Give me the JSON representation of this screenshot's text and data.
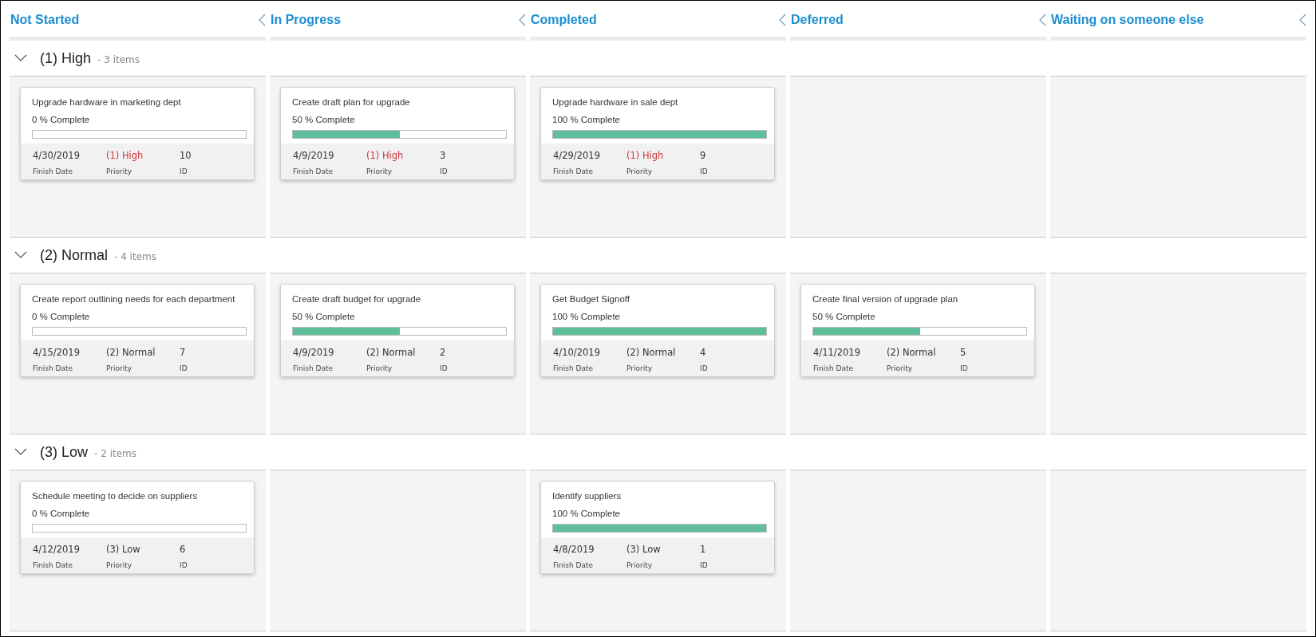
{
  "columns": [
    {
      "title": "Not Started",
      "kind": "not_started"
    },
    {
      "title": "In Progress",
      "kind": "in_progress"
    },
    {
      "title": "Completed",
      "kind": "completed"
    },
    {
      "title": "Deferred",
      "kind": "deferred"
    },
    {
      "title": "Waiting on someone else",
      "kind": "waiting"
    }
  ],
  "groups": [
    {
      "title": "(1) High",
      "count": "- 3 items",
      "expanded": true,
      "cards": [
        {
          "kind": "not_started",
          "title": "Upgrade hardware in marketing dept",
          "progress": "0 % Complete",
          "level": 0,
          "color": "#d13438",
          "fields": [
            {
              "value": "4/30/2019",
              "label": "Finish Date"
            },
            {
              "value": "(1) High",
              "label": "Priority"
            },
            {
              "value": "10",
              "label": "ID"
            }
          ]
        },
        {
          "kind": "in_progress",
          "title": "Create draft plan for upgrade",
          "progress": "50 % Complete",
          "level": 0.5,
          "color": "#d13438",
          "fields": [
            {
              "value": "4/9/2019",
              "label": "Finish Date"
            },
            {
              "value": "(1) High",
              "label": "Priority"
            },
            {
              "value": "3",
              "label": "ID"
            }
          ]
        },
        {
          "kind": "completed",
          "title": "Upgrade hardware in sale dept",
          "progress": "100 % Complete",
          "level": 1,
          "color": "#d13438",
          "fields": [
            {
              "value": "4/29/2019",
              "label": "Finish Date"
            },
            {
              "value": "(1) High",
              "label": "Priority"
            },
            {
              "value": "9",
              "label": "ID"
            }
          ]
        }
      ]
    },
    {
      "title": "(2) Normal",
      "count": "- 4 items",
      "expanded": true,
      "cards": [
        {
          "kind": "not_started",
          "title": "Create report outlining needs for each department",
          "progress": "0 % Complete",
          "level": 0,
          "color": "#333333",
          "fields": [
            {
              "value": "4/15/2019",
              "label": "Finish Date"
            },
            {
              "value": "(2) Normal",
              "label": "Priority"
            },
            {
              "value": "7",
              "label": "ID"
            }
          ]
        },
        {
          "kind": "in_progress",
          "title": "Create draft budget for upgrade",
          "progress": "50 % Complete",
          "level": 0.5,
          "color": "#333333",
          "fields": [
            {
              "value": "4/9/2019",
              "label": "Finish Date"
            },
            {
              "value": "(2) Normal",
              "label": "Priority"
            },
            {
              "value": "2",
              "label": "ID"
            }
          ]
        },
        {
          "kind": "completed",
          "title": "Get Budget Signoff",
          "progress": "100 % Complete",
          "level": 1,
          "color": "#333333",
          "fields": [
            {
              "value": "4/10/2019",
              "label": "Finish Date"
            },
            {
              "value": "(2) Normal",
              "label": "Priority"
            },
            {
              "value": "4",
              "label": "ID"
            }
          ]
        },
        {
          "kind": "deferred",
          "title": "Create final version of upgrade plan",
          "progress": "50 % Complete",
          "level": 0.5,
          "color": "#333333",
          "fields": [
            {
              "value": "4/11/2019",
              "label": "Finish Date"
            },
            {
              "value": "(2) Normal",
              "label": "Priority"
            },
            {
              "value": "5",
              "label": "ID"
            }
          ]
        }
      ]
    },
    {
      "title": "(3) Low",
      "count": "- 2 items",
      "expanded": true,
      "cards": [
        {
          "kind": "not_started",
          "title": "Schedule meeting to decide on suppliers",
          "progress": "0 % Complete",
          "level": 0,
          "color": "#333333",
          "fields": [
            {
              "value": "4/12/2019",
              "label": "Finish Date"
            },
            {
              "value": "(3) Low",
              "label": "Priority"
            },
            {
              "value": "6",
              "label": "ID"
            }
          ]
        },
        {
          "kind": "completed",
          "title": "Identify suppliers",
          "progress": "100 % Complete",
          "level": 1,
          "color": "#333333",
          "fields": [
            {
              "value": "4/8/2019",
              "label": "Finish Date"
            },
            {
              "value": "(3) Low",
              "label": "Priority"
            },
            {
              "value": "1",
              "label": "ID"
            }
          ]
        }
      ]
    }
  ]
}
